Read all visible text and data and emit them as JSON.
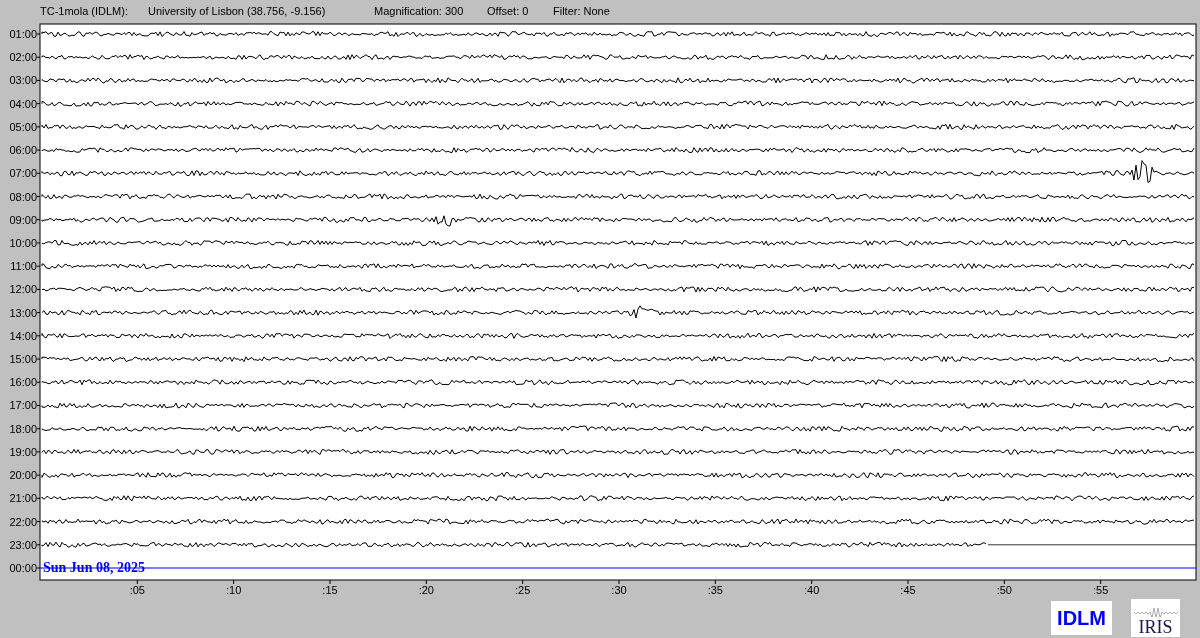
{
  "header": [
    "TC-1mola (IDLM):",
    "University of Lisbon (38.756, -9.156)",
    "Magnification: 300",
    "Offset: 0",
    "Filter: None"
  ],
  "rows": [
    {
      "label": "01:00",
      "kind": "full"
    },
    {
      "label": "02:00",
      "kind": "full"
    },
    {
      "label": "03:00",
      "kind": "full"
    },
    {
      "label": "04:00",
      "kind": "full"
    },
    {
      "label": "05:00",
      "kind": "full"
    },
    {
      "label": "06:00",
      "kind": "full"
    },
    {
      "label": "07:00",
      "kind": "full"
    },
    {
      "label": "08:00",
      "kind": "full"
    },
    {
      "label": "09:00",
      "kind": "full"
    },
    {
      "label": "10:00",
      "kind": "full"
    },
    {
      "label": "11:00",
      "kind": "full"
    },
    {
      "label": "12:00",
      "kind": "full"
    },
    {
      "label": "13:00",
      "kind": "full"
    },
    {
      "label": "14:00",
      "kind": "full"
    },
    {
      "label": "15:00",
      "kind": "full"
    },
    {
      "label": "16:00",
      "kind": "full"
    },
    {
      "label": "17:00",
      "kind": "full"
    },
    {
      "label": "18:00",
      "kind": "full"
    },
    {
      "label": "19:00",
      "kind": "full"
    },
    {
      "label": "20:00",
      "kind": "full"
    },
    {
      "label": "21:00",
      "kind": "full"
    },
    {
      "label": "22:00",
      "kind": "full"
    },
    {
      "label": "23:00",
      "kind": "partial",
      "level": 0.82
    },
    {
      "label": "00:00",
      "kind": "current"
    }
  ],
  "date_label": "Sun Jun 08, 2025",
  "x_ticks": [
    ":05",
    ":10",
    ":15",
    ":20",
    ":25",
    ":30",
    ":35",
    ":40",
    ":45",
    ":50",
    ":55"
  ],
  "logos": {
    "network": "IDLM",
    "iris": "IRIS"
  }
}
